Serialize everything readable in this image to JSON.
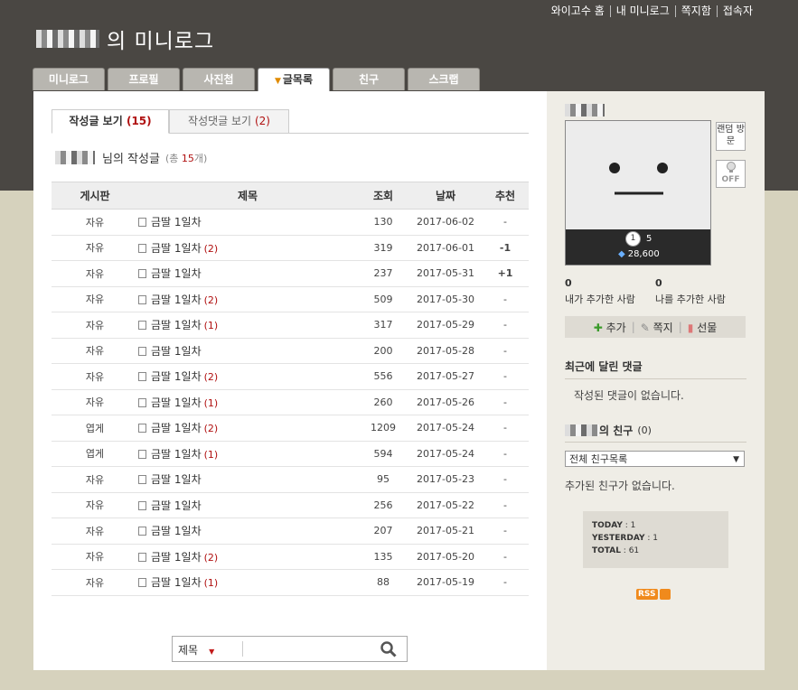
{
  "top_links": [
    "와이고수 홈",
    "내 미니로그",
    "쪽지함",
    "접속자"
  ],
  "site_title_suffix": "의 미니로그",
  "tabs": [
    "미니로그",
    "프로필",
    "사진첩",
    "글목록",
    "친구",
    "스크랩"
  ],
  "active_tab": "글목록",
  "subtabs": {
    "written": {
      "label": "작성글 보기",
      "count": "(15)"
    },
    "comments": {
      "label": "작성댓글 보기",
      "count": "(2)"
    }
  },
  "heading": {
    "text": "님의 작성글",
    "total_prefix": "(총 ",
    "total": "15",
    "total_suffix": "개)"
  },
  "columns": [
    "게시판",
    "제목",
    "조회",
    "날짜",
    "추천"
  ],
  "rows": [
    {
      "board": "자유",
      "title": "금딸 1일차",
      "comments": "",
      "views": "130",
      "date": "2017-06-02",
      "rec": "-"
    },
    {
      "board": "자유",
      "title": "금딸 1일차",
      "comments": "(2)",
      "views": "319",
      "date": "2017-06-01",
      "rec": "-1"
    },
    {
      "board": "자유",
      "title": "금딸 1일차",
      "comments": "",
      "views": "237",
      "date": "2017-05-31",
      "rec": "+1"
    },
    {
      "board": "자유",
      "title": "금딸 1일차",
      "comments": "(2)",
      "views": "509",
      "date": "2017-05-30",
      "rec": "-"
    },
    {
      "board": "자유",
      "title": "금딸 1일차",
      "comments": "(1)",
      "views": "317",
      "date": "2017-05-29",
      "rec": "-"
    },
    {
      "board": "자유",
      "title": "금딸 1일차",
      "comments": "",
      "views": "200",
      "date": "2017-05-28",
      "rec": "-"
    },
    {
      "board": "자유",
      "title": "금딸 1일차",
      "comments": "(2)",
      "views": "556",
      "date": "2017-05-27",
      "rec": "-"
    },
    {
      "board": "자유",
      "title": "금딸 1일차",
      "comments": "(1)",
      "views": "260",
      "date": "2017-05-26",
      "rec": "-"
    },
    {
      "board": "엽게",
      "title": "금딸 1일차",
      "comments": "(2)",
      "views": "1209",
      "date": "2017-05-24",
      "rec": "-"
    },
    {
      "board": "엽게",
      "title": "금딸 1일차",
      "comments": "(1)",
      "views": "594",
      "date": "2017-05-24",
      "rec": "-"
    },
    {
      "board": "자유",
      "title": "금딸 1일차",
      "comments": "",
      "views": "95",
      "date": "2017-05-23",
      "rec": "-"
    },
    {
      "board": "자유",
      "title": "금딸 1일차",
      "comments": "",
      "views": "256",
      "date": "2017-05-22",
      "rec": "-"
    },
    {
      "board": "자유",
      "title": "금딸 1일차",
      "comments": "",
      "views": "207",
      "date": "2017-05-21",
      "rec": "-"
    },
    {
      "board": "자유",
      "title": "금딸 1일차",
      "comments": "(2)",
      "views": "135",
      "date": "2017-05-20",
      "rec": "-"
    },
    {
      "board": "자유",
      "title": "금딸 1일차",
      "comments": "(1)",
      "views": "88",
      "date": "2017-05-19",
      "rec": "-"
    }
  ],
  "search": {
    "field": "제목"
  },
  "sidebar": {
    "random_visit": "랜덤 방문",
    "off_label": "OFF",
    "level": "1",
    "level_value": "5",
    "points": "28,600",
    "added_by_me_count": "0",
    "added_by_me_label": "내가 추가한 사람",
    "added_me_count": "0",
    "added_me_label": "나를 추가한 사람",
    "actions": {
      "add": "추가",
      "message": "쪽지",
      "gift": "선물"
    },
    "recent_comments_title": "최근에 달린 댓글",
    "recent_comments_empty": "작성된 댓글이 없습니다.",
    "friends_title": "의 친구",
    "friends_count": "(0)",
    "friends_select": "전체 친구목록",
    "friends_empty": "추가된 친구가 없습니다.",
    "today_label": "TODAY",
    "today": "1",
    "yesterday_label": "YESTERDAY",
    "yesterday": "1",
    "total_label": "TOTAL",
    "total": "61",
    "rss": "RSS"
  },
  "colors": {
    "header_bg": "#4a4743",
    "page_bg": "#d6d2bd",
    "sidebar_bg": "#efede6",
    "accent_red": "#b01010",
    "board_gold": "#c98a1f"
  }
}
